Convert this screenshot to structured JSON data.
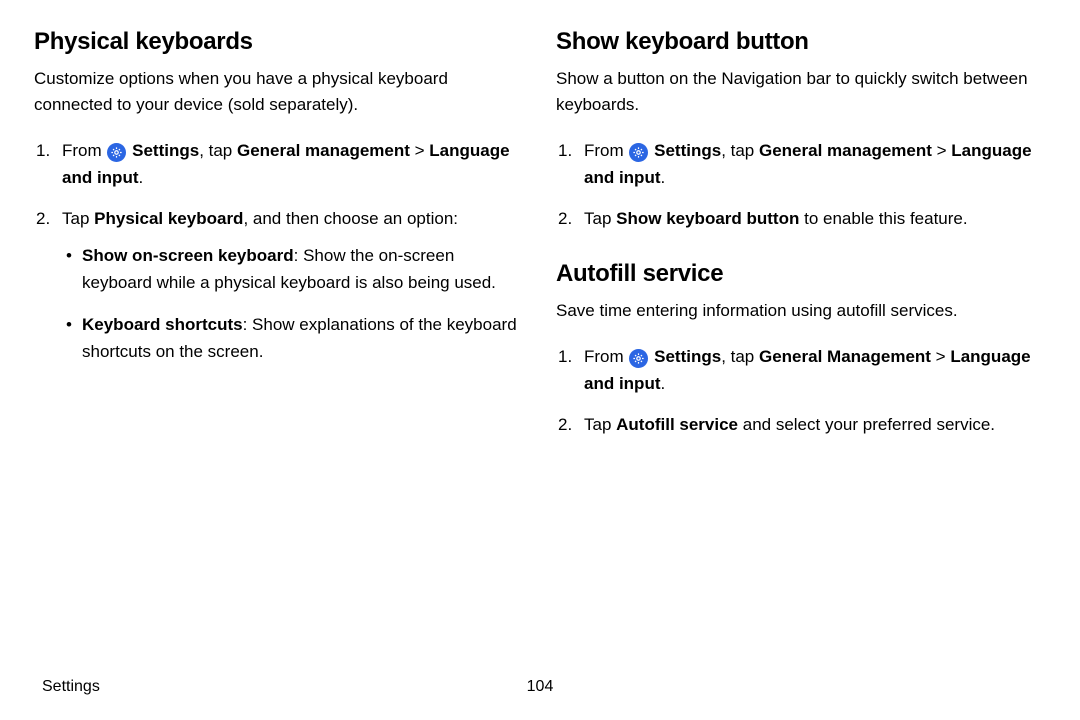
{
  "left": {
    "title": "Physical keyboards",
    "intro": "Customize options when you have a physical keyboard connected to your device (sold separately).",
    "step1_a": "From ",
    "step1_b": " Settings",
    "step1_c": ", tap ",
    "step1_d": "General management",
    "step1_e": " > ",
    "step1_f": "Language and input",
    "step1_g": ".",
    "step2_a": "Tap ",
    "step2_b": "Physical keyboard",
    "step2_c": ", and then choose an option:",
    "bullet1_a": "Show on-screen keyboard",
    "bullet1_b": ": Show the on-screen keyboard while a physical keyboard is also being used.",
    "bullet2_a": "Keyboard shortcuts",
    "bullet2_b": ": Show explanations of the keyboard shortcuts on the screen."
  },
  "right_top": {
    "title": "Show keyboard button",
    "intro": "Show a button on the Navigation bar to quickly switch between keyboards.",
    "step1_a": "From ",
    "step1_b": " Settings",
    "step1_c": ", tap ",
    "step1_d": "General management",
    "step1_e": " > ",
    "step1_f": "Language and input",
    "step1_g": ".",
    "step2_a": "Tap ",
    "step2_b": "Show keyboard button",
    "step2_c": " to enable this feature."
  },
  "right_bottom": {
    "title": "Autofill service",
    "intro": "Save time entering information using autofill services.",
    "step1_a": "From ",
    "step1_b": " Settings",
    "step1_c": ", tap ",
    "step1_d": "General Management",
    "step1_e": " > ",
    "step1_f": "Language and input",
    "step1_g": ".",
    "step2_a": "Tap ",
    "step2_b": "Autofill service",
    "step2_c": " and select your preferred service."
  },
  "footer": {
    "label": "Settings",
    "page": "104"
  }
}
